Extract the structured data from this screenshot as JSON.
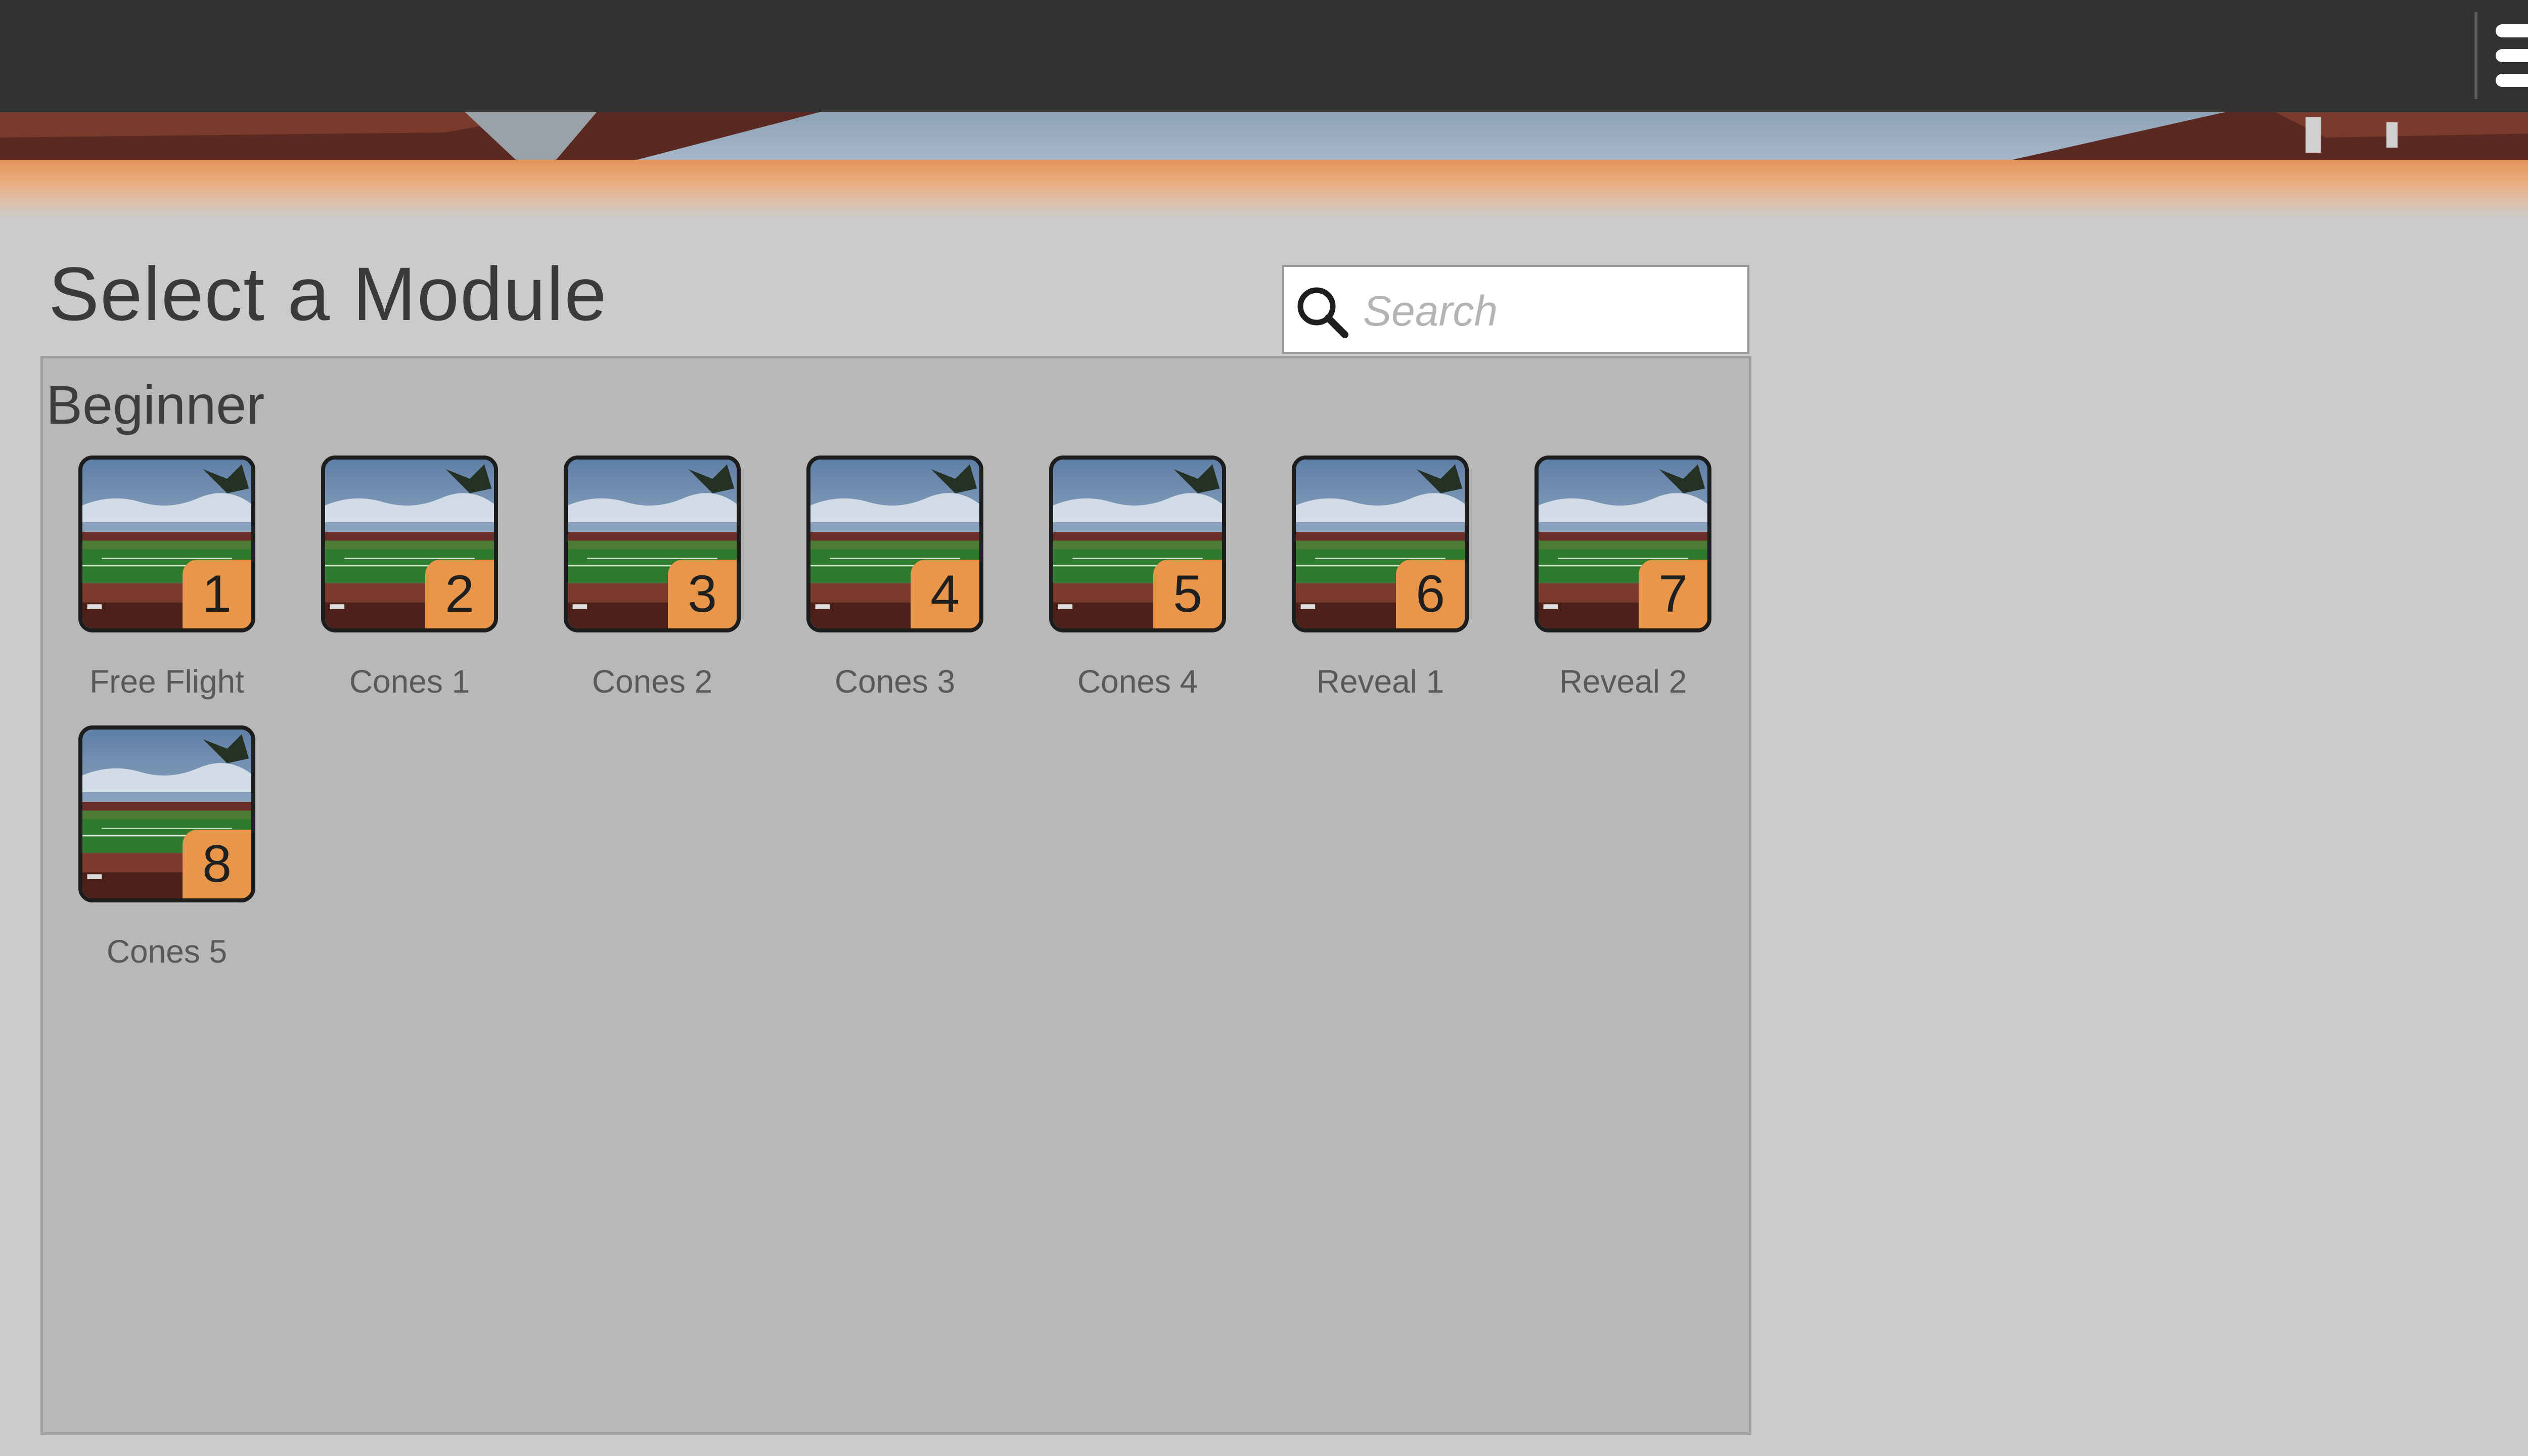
{
  "header": {
    "menu_icon": "hamburger-menu-icon"
  },
  "page": {
    "title": "Select a Module"
  },
  "search": {
    "placeholder": "Search",
    "icon": "search-icon"
  },
  "section": {
    "title": "Beginner",
    "modules": [
      {
        "number": "1",
        "label": "Free Flight"
      },
      {
        "number": "2",
        "label": "Cones 1"
      },
      {
        "number": "3",
        "label": "Cones 2"
      },
      {
        "number": "4",
        "label": "Cones 3"
      },
      {
        "number": "5",
        "label": "Cones 4"
      },
      {
        "number": "6",
        "label": "Reveal 1"
      },
      {
        "number": "7",
        "label": "Reveal 2"
      },
      {
        "number": "8",
        "label": "Cones 5"
      }
    ]
  },
  "colors": {
    "topbar": "#323232",
    "accent_orange": "#e8974a",
    "background": "#cbcbcb",
    "panel": "#b8b8b8"
  }
}
